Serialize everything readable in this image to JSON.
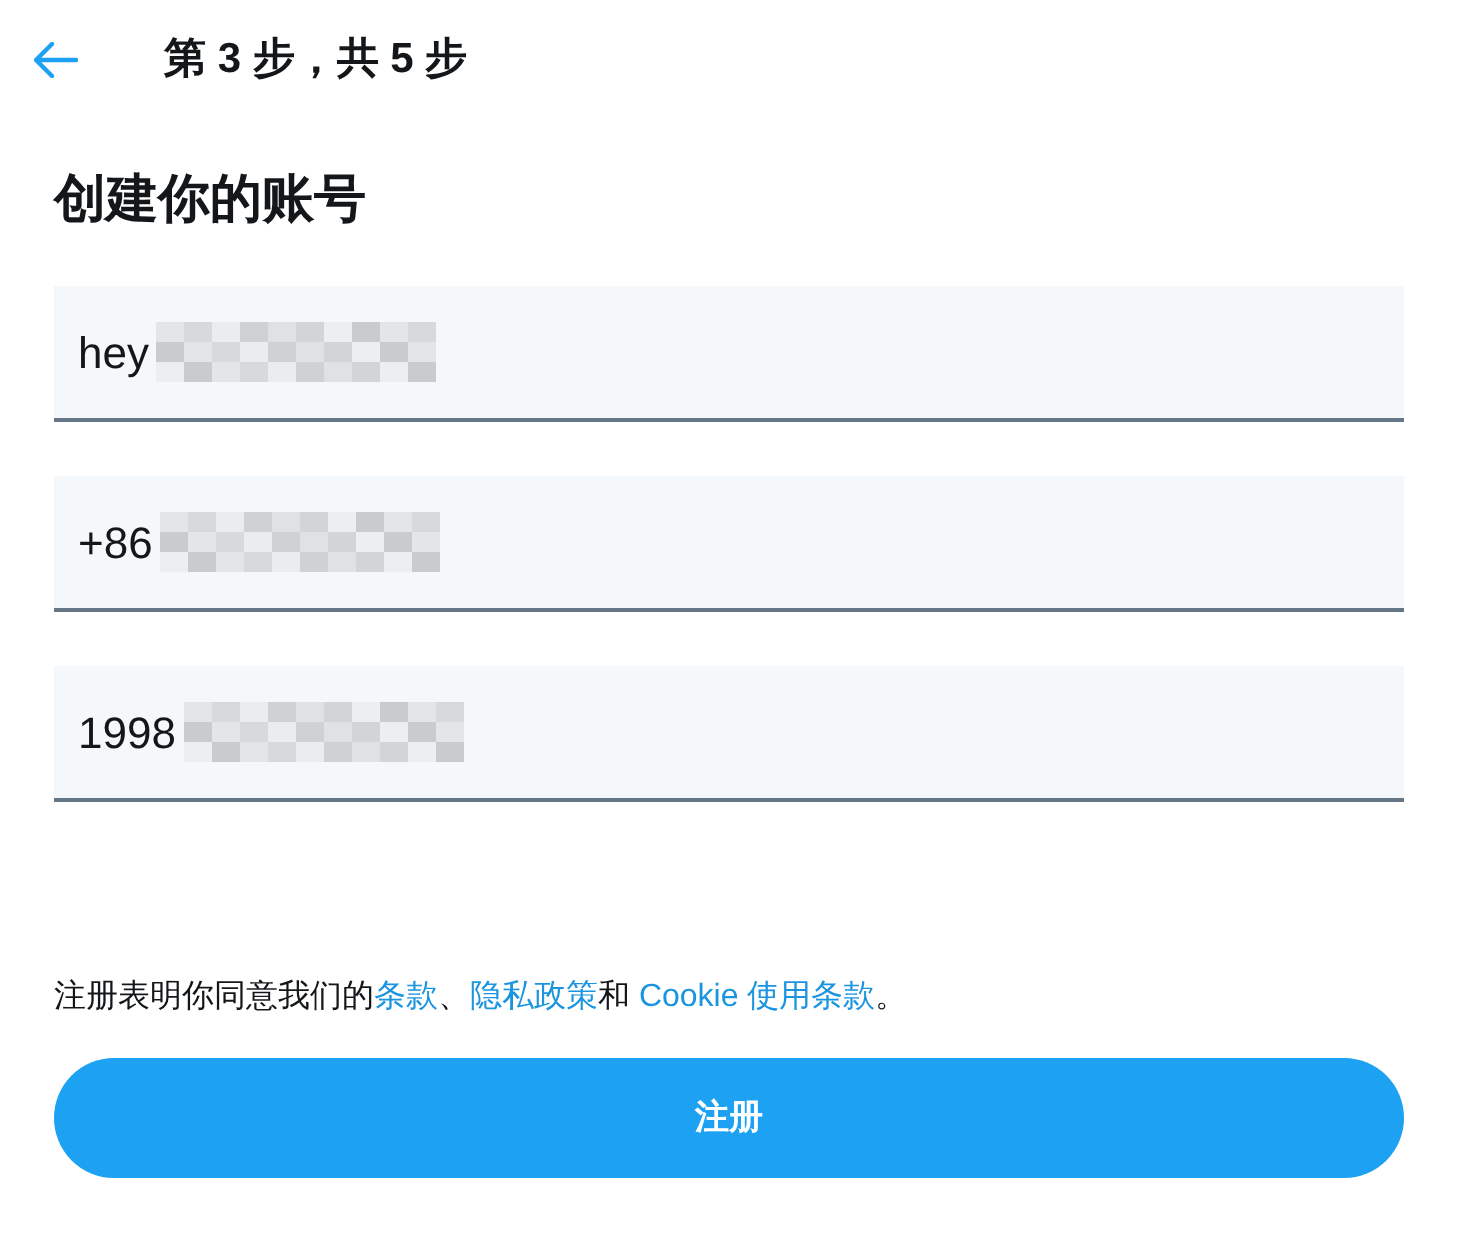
{
  "header": {
    "step": "第 3 步，共 5 步"
  },
  "heading": "创建你的账号",
  "fields": [
    {
      "value": "hey",
      "redacted": true
    },
    {
      "value": "+86",
      "redacted": true
    },
    {
      "value": "1998",
      "redacted": true
    }
  ],
  "terms": {
    "parts": [
      {
        "text": "注册表明你同意我们的",
        "link": false
      },
      {
        "text": "条款",
        "link": true
      },
      {
        "text": "、",
        "link": false
      },
      {
        "text": "隐私政策",
        "link": true
      },
      {
        "text": "和 ",
        "link": false
      },
      {
        "text": "Cookie 使用条款",
        "link": true
      },
      {
        "text": "。",
        "link": false
      }
    ]
  },
  "submit": "注册"
}
